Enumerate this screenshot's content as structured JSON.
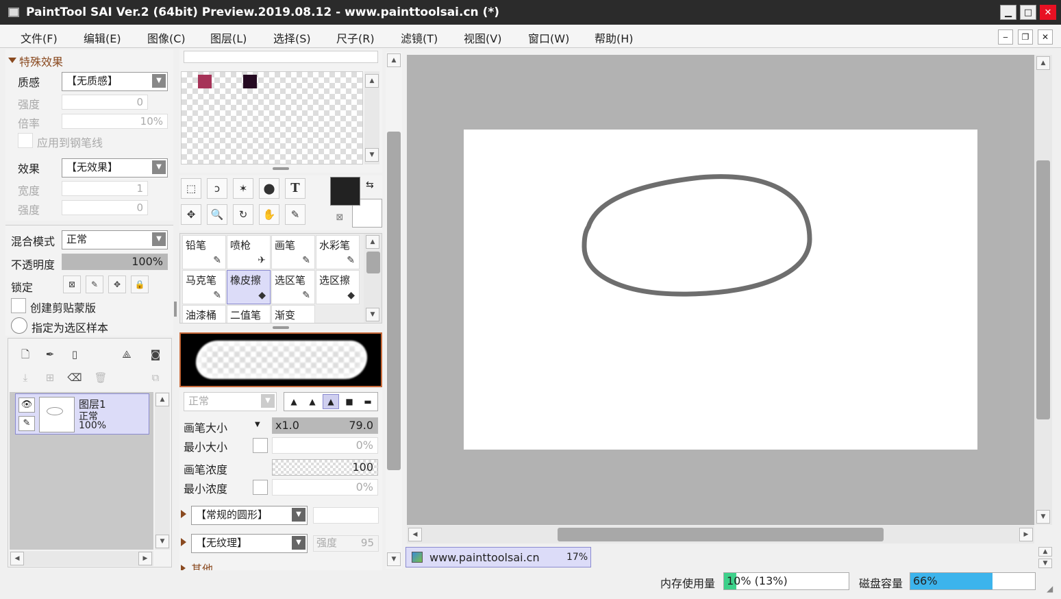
{
  "window": {
    "title": "PaintTool SAI Ver.2 (64bit) Preview.2019.08.12 - www.painttoolsai.cn (*)",
    "btn_min": "▁",
    "btn_max": "□",
    "btn_close": "✕"
  },
  "menu": [
    "文件(F)",
    "编辑(E)",
    "图像(C)",
    "图层(L)",
    "选择(S)",
    "尺子(R)",
    "滤镜(T)",
    "视图(V)",
    "窗口(W)",
    "帮助(H)"
  ],
  "mdi": {
    "min": "‒",
    "restore": "❐",
    "close": "✕"
  },
  "effects": {
    "section_title": "特殊效果",
    "texture_label": "质感",
    "texture_value": "【无质感】",
    "strength_label": "强度",
    "strength_value": "0",
    "scale_label": "倍率",
    "scale_value": "10%",
    "apply_pen_label": "应用到钢笔线",
    "effect_label": "效果",
    "effect_value": "【无效果】",
    "width_label": "宽度",
    "width_value": "1",
    "strength2_label": "强度",
    "strength2_value": "0"
  },
  "layer_props": {
    "blend_label": "混合模式",
    "blend_value": "正常",
    "opacity_label": "不透明度",
    "opacity_value": "100%",
    "lock_label": "锁定",
    "clip_label": "创建剪贴蒙版",
    "sample_label": "指定为选区样本"
  },
  "layers": [
    {
      "name": "图层1",
      "mode": "正常",
      "opacity": "100%"
    }
  ],
  "swatches": {
    "colors": [
      "#a63358",
      "#250a22"
    ]
  },
  "tools": {
    "row1": [
      "⬚",
      "ↄ",
      "✶",
      "⬤",
      "T"
    ],
    "row2": [
      "✥",
      "🔍",
      "↻",
      "✋",
      "✎"
    ],
    "primary_color": "#222222",
    "secondary_color": "#ffffff",
    "swap_icon": "⇆"
  },
  "brushes": [
    {
      "label": "铅笔",
      "icon": "✎"
    },
    {
      "label": "喷枪",
      "icon": "✈"
    },
    {
      "label": "画笔",
      "icon": "✎"
    },
    {
      "label": "水彩笔",
      "icon": "✎"
    },
    {
      "label": "马克笔",
      "icon": "✎"
    },
    {
      "label": "橡皮擦",
      "icon": "◆",
      "selected": true
    },
    {
      "label": "选区笔",
      "icon": "✎"
    },
    {
      "label": "选区擦",
      "icon": "◆"
    },
    {
      "label": "油漆桶",
      "icon": ""
    },
    {
      "label": "二值笔",
      "icon": ""
    },
    {
      "label": "渐变",
      "icon": ""
    }
  ],
  "brush_settings": {
    "mode_value": "正常",
    "shapes": [
      "▲",
      "▲",
      "▲",
      "■",
      "▬"
    ],
    "size_label": "画笔大小",
    "size_mult": "x1.0",
    "size_value": "79.0",
    "min_size_label": "最小大小",
    "min_size_value": "0%",
    "density_label": "画笔浓度",
    "density_value": "100",
    "min_density_label": "最小浓度",
    "min_density_value": "0%",
    "shape_value": "【常规的圆形】",
    "texture_value": "【无纹理】",
    "texture_strength_label": "强度",
    "texture_strength_value": "95",
    "other_label": "其他"
  },
  "canvas_tab": {
    "name": "www.painttoolsai.cn",
    "zoom": "17%"
  },
  "status": {
    "memory_label": "内存使用量",
    "memory_value": "10% (13%)",
    "memory_fraction": 0.1,
    "disk_label": "磁盘容量",
    "disk_value": "66%",
    "disk_fraction": 0.66
  },
  "colors": {
    "accent": "#3cb4ec",
    "memory_bar": "#3dd18a",
    "selection": "#dcdcf8"
  }
}
